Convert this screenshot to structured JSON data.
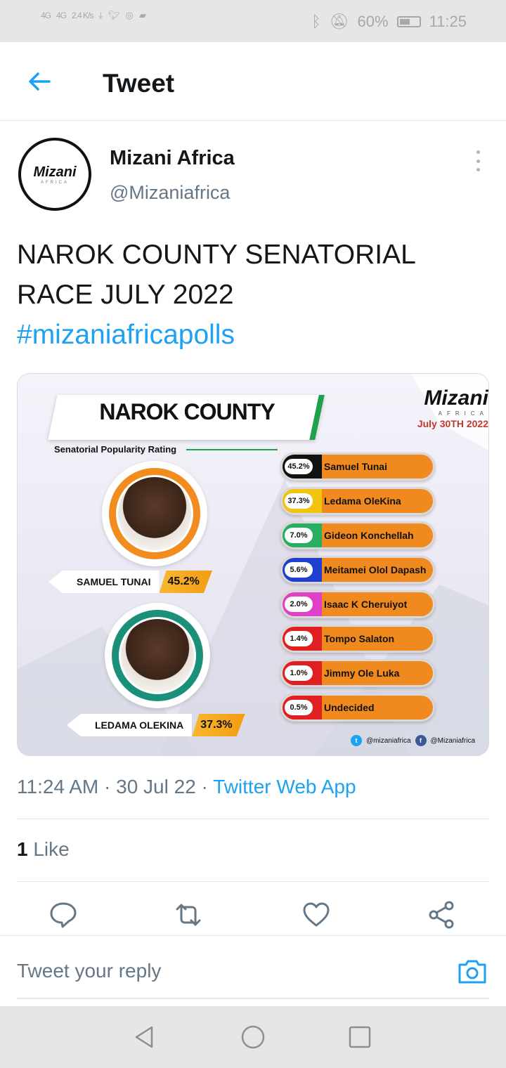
{
  "status_bar": {
    "left": [
      "4G",
      "4G",
      "2.4 K/s",
      "download",
      "twitter",
      "whatsapp",
      "message"
    ],
    "battery": "60%",
    "time": "11:25"
  },
  "header": {
    "title": "Tweet",
    "back_icon": "arrow-left-icon"
  },
  "author": {
    "name": "Mizani Africa",
    "handle": "@Mizaniafrica",
    "avatar_text": "Mizani",
    "avatar_sub": "AFRICA"
  },
  "tweet": {
    "text": "NAROK COUNTY SENATORIAL RACE JULY 2022",
    "hashtag": "#mizaniafricapolls"
  },
  "poll_image": {
    "title": "NAROK COUNTY",
    "subtitle": "Senatorial Popularity Rating",
    "brand": "Mizani",
    "brand_sub": "AFRICA",
    "date": "July 30TH 2022",
    "leaders": [
      {
        "name": "SAMUEL TUNAI",
        "pct": "45.2%"
      },
      {
        "name": "LEDAMA OLEKINA",
        "pct": "37.3%"
      }
    ],
    "candidates": [
      {
        "pct": "45.2%",
        "name": "Samuel Tunai",
        "color": "#111111"
      },
      {
        "pct": "37.3%",
        "name": "Ledama OleKina",
        "color": "#f1c40f"
      },
      {
        "pct": "7.0%",
        "name": "Gideon Konchellah",
        "color": "#27ae60"
      },
      {
        "pct": "5.6%",
        "name": "Meitamei Olol Dapash",
        "color": "#1e3fd0"
      },
      {
        "pct": "2.0%",
        "name": "Isaac K Cheruiyot",
        "color": "#e040c8"
      },
      {
        "pct": "1.4%",
        "name": "Tompo Salaton",
        "color": "#e02020"
      },
      {
        "pct": "1.0%",
        "name": "Jimmy Ole Luka",
        "color": "#e02020"
      },
      {
        "pct": "0.5%",
        "name": "Undecided",
        "color": "#e02020"
      }
    ],
    "social_twitter": "@mizaniafrica",
    "social_facebook": "@Mizaniafrica"
  },
  "meta": {
    "time": "11:24 AM",
    "date": "30 Jul 22",
    "source": "Twitter Web App"
  },
  "likes": {
    "count": "1",
    "label": "Like"
  },
  "reply": {
    "placeholder": "Tweet your reply"
  }
}
